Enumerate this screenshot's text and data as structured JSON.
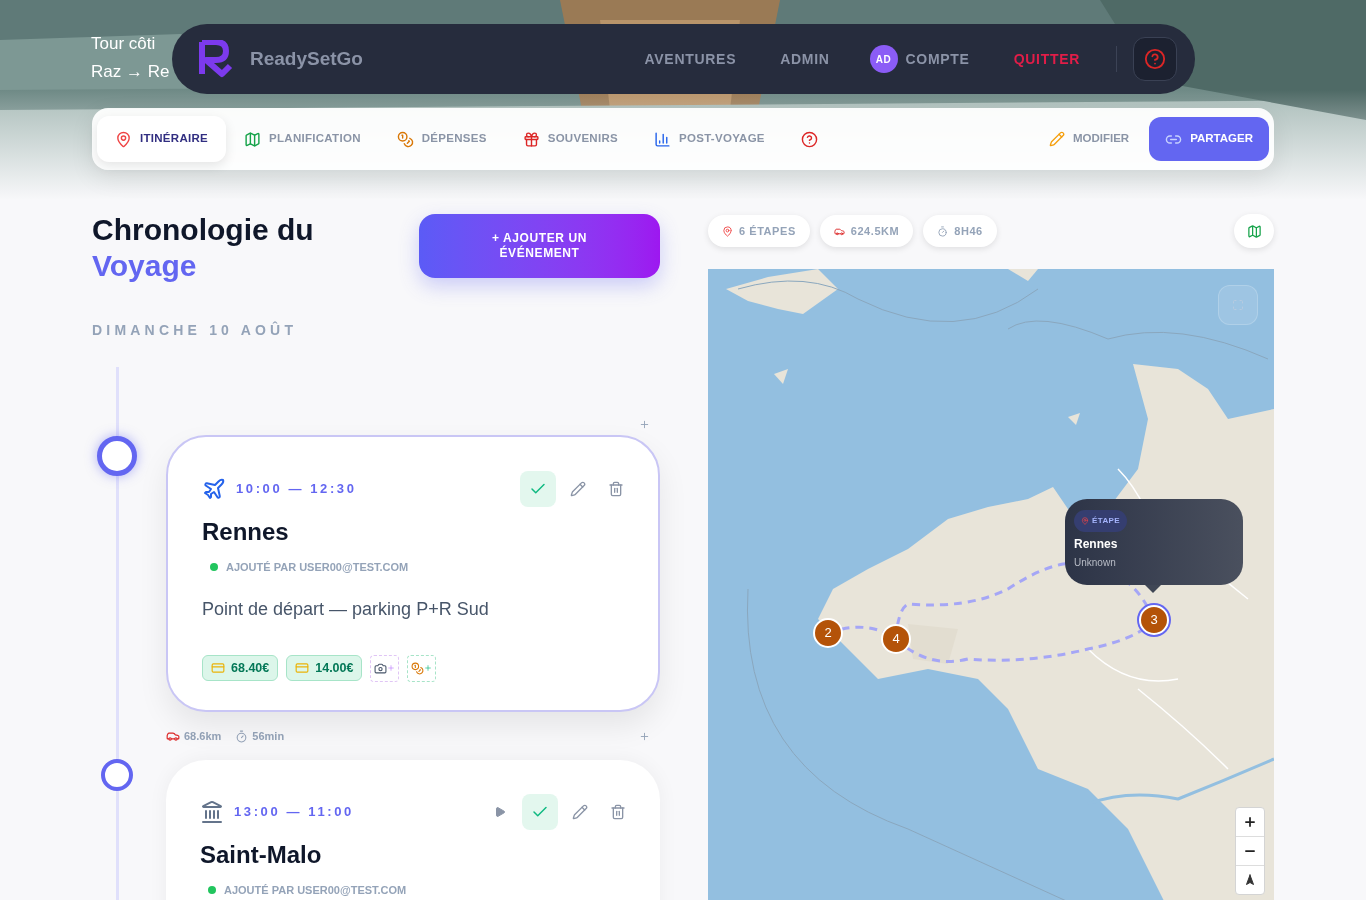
{
  "hero": {
    "subtitle_lines": [
      "Tour côti",
      "Raz → Re"
    ]
  },
  "navbar": {
    "brand": "ReadySetGo",
    "links": [
      {
        "label": "AVENTURES",
        "kind": "link"
      },
      {
        "label": "ADMIN",
        "kind": "link"
      },
      {
        "label": "COMPTE",
        "kind": "account",
        "avatar": "AD"
      },
      {
        "label": "QUITTER",
        "kind": "danger"
      }
    ]
  },
  "tabs": [
    {
      "kind": "pin",
      "label": "ITINÉRAIRE",
      "selected": true
    },
    {
      "kind": "map",
      "label": "PLANIFICATION",
      "selected": false
    },
    {
      "kind": "money",
      "label": "DÉPENSES",
      "selected": false
    },
    {
      "kind": "gift",
      "label": "SOUVENIRS",
      "selected": false
    },
    {
      "kind": "chart",
      "label": "POST-VOYAGE",
      "selected": false
    },
    {
      "kind": "help",
      "selected": false
    }
  ],
  "actions": [
    {
      "kind": "plain",
      "label": "MODIFIER"
    },
    {
      "kind": "primary",
      "label": "PARTAGER"
    }
  ],
  "timeline": {
    "title": "Chronologie du",
    "title_accent": "Voyage",
    "add_button": "+ AJOUTER UN ÉVÉNEMENT",
    "day": "DIMANCHE 10 AOÛT",
    "events": [
      {
        "kind": "flight",
        "time": "10:00 — 12:30",
        "title": "Rennes",
        "added_by": "AJOUTÉ PAR USER00@TEST.COM",
        "note": "Point de départ — parking P+R Sud",
        "done": true,
        "playable": false,
        "expenses": [
          "68.40€",
          "14.00€"
        ]
      },
      {
        "kind": "monument",
        "time": "13:00 — 11:00",
        "title": "Saint-Malo",
        "added_by": "AJOUTÉ PAR USER00@TEST.COM",
        "done": true,
        "playable": true
      }
    ],
    "legs": [
      {
        "distance": "68.6km",
        "duration": "56min"
      }
    ]
  },
  "map": {
    "stats": [
      {
        "kind": "pin",
        "label": "6 ÉTAPES"
      },
      {
        "kind": "car",
        "label": "624.5KM"
      },
      {
        "kind": "timer",
        "label": "8H46"
      }
    ],
    "markers": [
      {
        "label": "2",
        "selected": false
      },
      {
        "label": "4",
        "selected": false
      },
      {
        "label": "3",
        "selected": true
      }
    ],
    "popup": {
      "tag": "ÉTAPE",
      "title": "Rennes",
      "subtitle": "Unknown"
    }
  }
}
